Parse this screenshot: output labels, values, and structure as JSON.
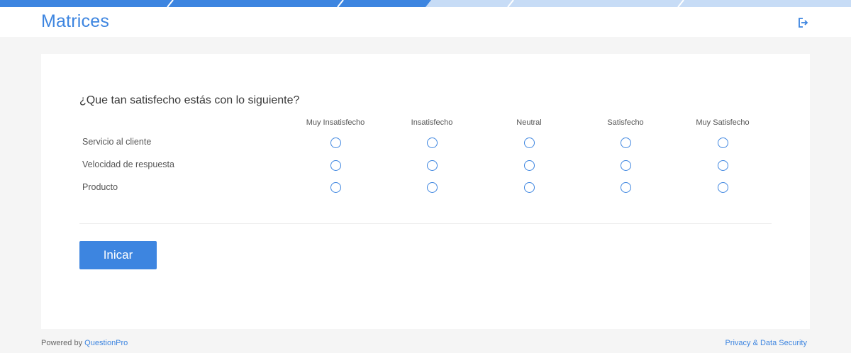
{
  "header": {
    "title": "Matrices"
  },
  "survey": {
    "question": "¿Que tan satisfecho estás con lo siguiente?",
    "columns": [
      "Muy Insatisfecho",
      "Insatisfecho",
      "Neutral",
      "Satisfecho",
      "Muy Satisfecho"
    ],
    "rows": [
      "Servicio al cliente",
      "Velocidad de respuesta",
      "Producto"
    ],
    "start_label": "Inicar"
  },
  "footer": {
    "powered_prefix": "Powered by",
    "powered_link": "QuestionPro",
    "privacy_link": "Privacy & Data Security"
  },
  "colors": {
    "accent": "#3d85e0",
    "bar_light": "#c7dcf6"
  },
  "icons": {
    "logout": "logout-icon"
  }
}
